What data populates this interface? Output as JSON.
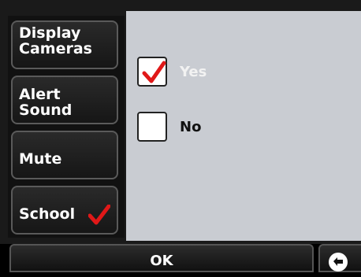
{
  "sidebar": {
    "items": [
      {
        "label": "Display\nCameras"
      },
      {
        "label": "Alert\nSound"
      },
      {
        "label": "Mute"
      },
      {
        "label": "School",
        "checked": true
      }
    ]
  },
  "options": [
    {
      "label": "Yes",
      "checked": true
    },
    {
      "label": "No",
      "checked": false
    }
  ],
  "footer": {
    "ok_label": "OK",
    "back_icon": "back-arrow-icon"
  },
  "colors": {
    "check_red": "#e01818",
    "panel_bg": "#c9ccd2",
    "button_dark": "#1a1a1a"
  }
}
